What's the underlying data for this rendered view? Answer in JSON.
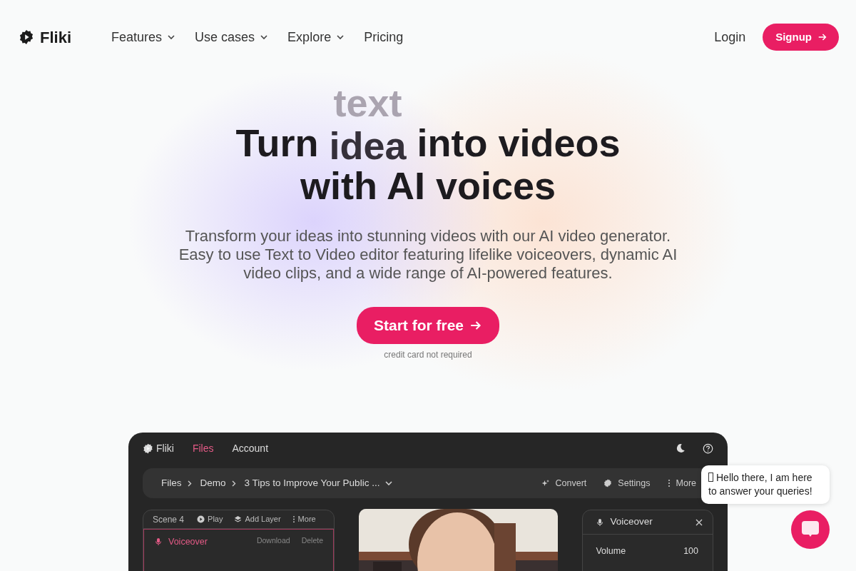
{
  "nav": {
    "logo": "Fliki",
    "items": [
      {
        "label": "Features",
        "dropdown": true
      },
      {
        "label": "Use cases",
        "dropdown": true
      },
      {
        "label": "Explore",
        "dropdown": true
      },
      {
        "label": "Pricing",
        "dropdown": false
      }
    ],
    "login": "Login",
    "signup": "Signup"
  },
  "hero": {
    "rotating_previous": "text",
    "title_before": "Turn",
    "rotating_word": "idea",
    "title_after": "into videos",
    "title_line2": "with AI voices",
    "subtitle": "Transform your ideas into stunning videos with our AI video generator. Easy to use Text to Video editor featuring lifelike voiceovers, dynamic AI video clips, and a wide range of AI-powered features.",
    "cta": "Start for free",
    "note": "credit card not required"
  },
  "app_preview": {
    "brand": "Fliki",
    "tabs": [
      {
        "label": "Files",
        "selected": true
      },
      {
        "label": "Account",
        "selected": false
      }
    ],
    "breadcrumb": [
      "Files",
      "Demo",
      "3 Tips to Improve Your Public ..."
    ],
    "actions": [
      {
        "label": "Convert",
        "kind": "sparkle"
      },
      {
        "label": "Settings",
        "kind": "gear"
      },
      {
        "label": "More",
        "kind": "dots"
      }
    ],
    "scene": {
      "title": "Scene 4",
      "actions": [
        {
          "label": "Play",
          "kind": "play"
        },
        {
          "label": "Add Layer",
          "kind": "layers"
        },
        {
          "label": "More",
          "kind": "dots"
        }
      ],
      "layer": {
        "label": "Voiceover",
        "actions": [
          "Download",
          "Delete"
        ]
      }
    },
    "video": {
      "kind": "picture"
    },
    "panel": {
      "title": "Voiceover",
      "fields": [
        {
          "label": "Volume",
          "value": "100"
        }
      ]
    }
  },
  "chat": {
    "message": "Hello there, I am here to answer your queries!"
  }
}
